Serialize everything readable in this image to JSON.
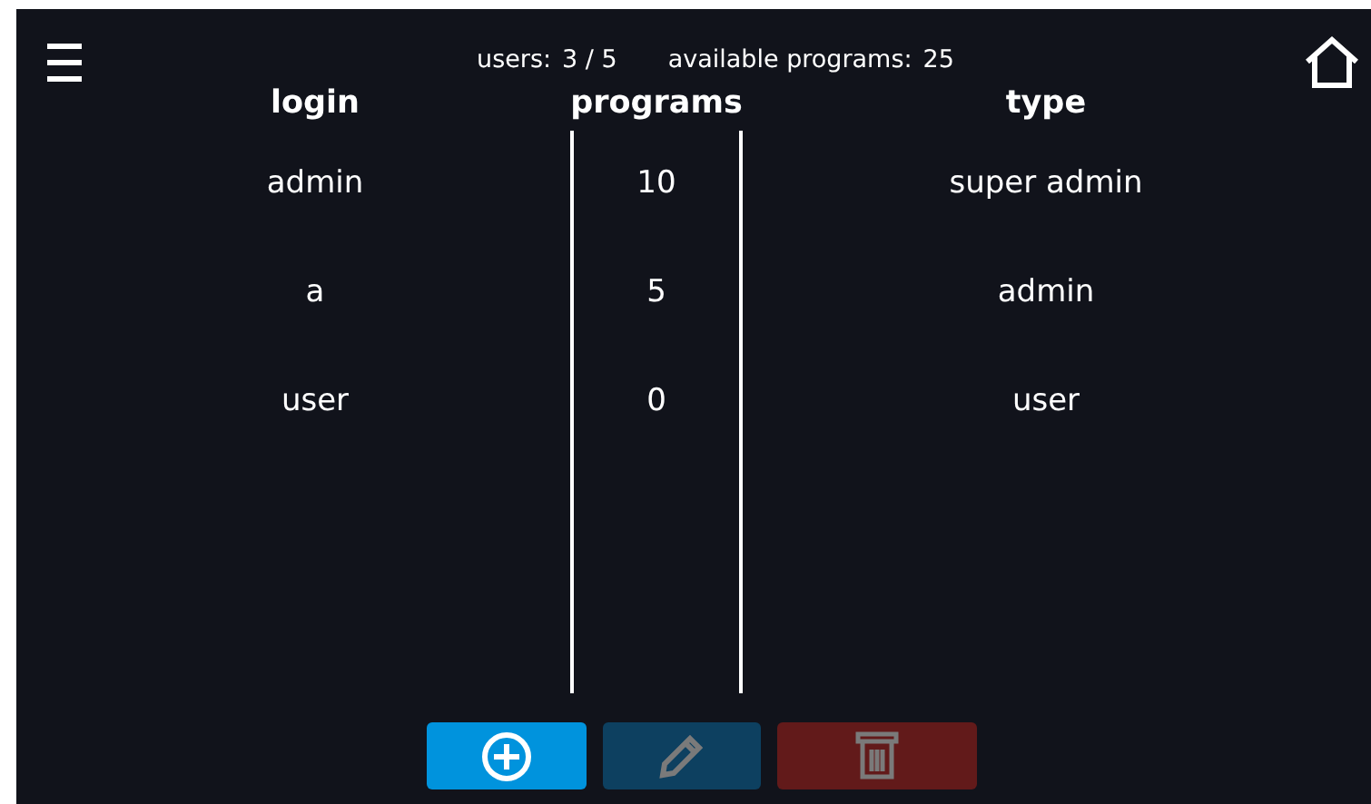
{
  "header": {
    "users_label": "users:",
    "users_value": "3 / 5",
    "programs_label": "available programs:",
    "programs_value": "25"
  },
  "table": {
    "columns": [
      "login",
      "programs",
      "type"
    ],
    "rows": [
      {
        "login": "admin",
        "programs": "10",
        "type": "super admin"
      },
      {
        "login": "a",
        "programs": "5",
        "type": "admin"
      },
      {
        "login": "user",
        "programs": "0",
        "type": "user"
      }
    ]
  },
  "buttons": [
    {
      "kind": "add",
      "disabled": false
    },
    {
      "kind": "edit",
      "disabled": true
    },
    {
      "kind": "delete",
      "disabled": true
    }
  ]
}
